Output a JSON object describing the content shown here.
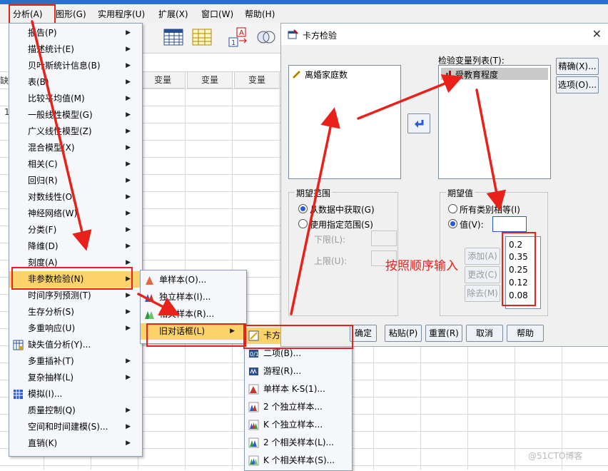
{
  "menubar": [
    "分析(A)",
    "图形(G)",
    "实用程序(U)",
    "扩展(X)",
    "窗口(W)",
    "帮助(H)"
  ],
  "grid": {
    "columns": [
      "变量",
      "变量",
      "变量"
    ],
    "left_partial": "缺数",
    "row1": "1"
  },
  "analyze_menu": [
    {
      "label": "报告(P)",
      "arrow": true
    },
    {
      "label": "描述统计(E)",
      "arrow": true
    },
    {
      "label": "贝叶斯统计信息(B)",
      "arrow": true
    },
    {
      "label": "表(B)",
      "arrow": true
    },
    {
      "label": "比较平均值(M)",
      "arrow": true
    },
    {
      "label": "一般线性模型(G)",
      "arrow": true
    },
    {
      "label": "广义线性模型(Z)",
      "arrow": true
    },
    {
      "label": "混合模型(X)",
      "arrow": true
    },
    {
      "label": "相关(C)",
      "arrow": true
    },
    {
      "label": "回归(R)",
      "arrow": true
    },
    {
      "label": "对数线性(O)",
      "arrow": true
    },
    {
      "label": "神经网络(W)",
      "arrow": true
    },
    {
      "label": "分类(F)",
      "arrow": true
    },
    {
      "label": "降维(D)",
      "arrow": true
    },
    {
      "label": "刻度(A)",
      "arrow": true
    },
    {
      "label": "非参数检验(N)",
      "arrow": true
    },
    {
      "label": "时间序列预测(T)",
      "arrow": true
    },
    {
      "label": "生存分析(S)",
      "arrow": true
    },
    {
      "label": "多重响应(U)",
      "arrow": true
    },
    {
      "label": "缺失值分析(Y)...",
      "arrow": false
    },
    {
      "label": "多重插补(T)",
      "arrow": true
    },
    {
      "label": "复杂抽样(L)",
      "arrow": true
    },
    {
      "label": "模拟(I)...",
      "arrow": false
    },
    {
      "label": "质量控制(Q)",
      "arrow": true
    },
    {
      "label": "空间和时间建模(S)...",
      "arrow": true
    },
    {
      "label": "直销(K)",
      "arrow": true
    }
  ],
  "nonparam_menu": [
    "单样本(O)...",
    "独立样本(I)...",
    "相关样本(R)...",
    "旧对话框(L)"
  ],
  "legacy_menu": [
    "卡方(C)...",
    "二项(B)...",
    "游程(R)...",
    "单样本 K-S(1)...",
    "2 个独立样本...",
    "K 个独立样本...",
    "2 个相关样本(L)...",
    "K 个相关样本(S)..."
  ],
  "dialog": {
    "title": "卡方检验",
    "source_item": "离婚家庭数",
    "test_list_label": "检验变量列表(T):",
    "test_item": "受教育程度",
    "btn_exact": "精确(X)...",
    "btn_options": "选项(O)...",
    "range_group": "期望范围",
    "range_opt1": "从数据中获取(G)",
    "range_opt2": "使用指定范围(S)",
    "lower": "下限(L):",
    "upper": "上限(U):",
    "exp_group": "期望值",
    "exp_opt1": "所有类别相等(I)",
    "exp_opt2": "值(V):",
    "btn_add": "添加(A)",
    "btn_change": "更改(C)",
    "btn_remove": "除去(M)",
    "values": [
      "0.2",
      "0.35",
      "0.25",
      "0.12",
      "0.08"
    ],
    "btn_ok": "确定",
    "btn_paste": "粘贴(P)",
    "btn_reset": "重置(R)",
    "btn_cancel": "取消",
    "btn_help": "帮助"
  },
  "annotation": "按照顺序输入",
  "watermark": "@51CTO博客",
  "colors": {
    "highlight": "#fbd36a",
    "annotation_red": "#e8221b"
  }
}
